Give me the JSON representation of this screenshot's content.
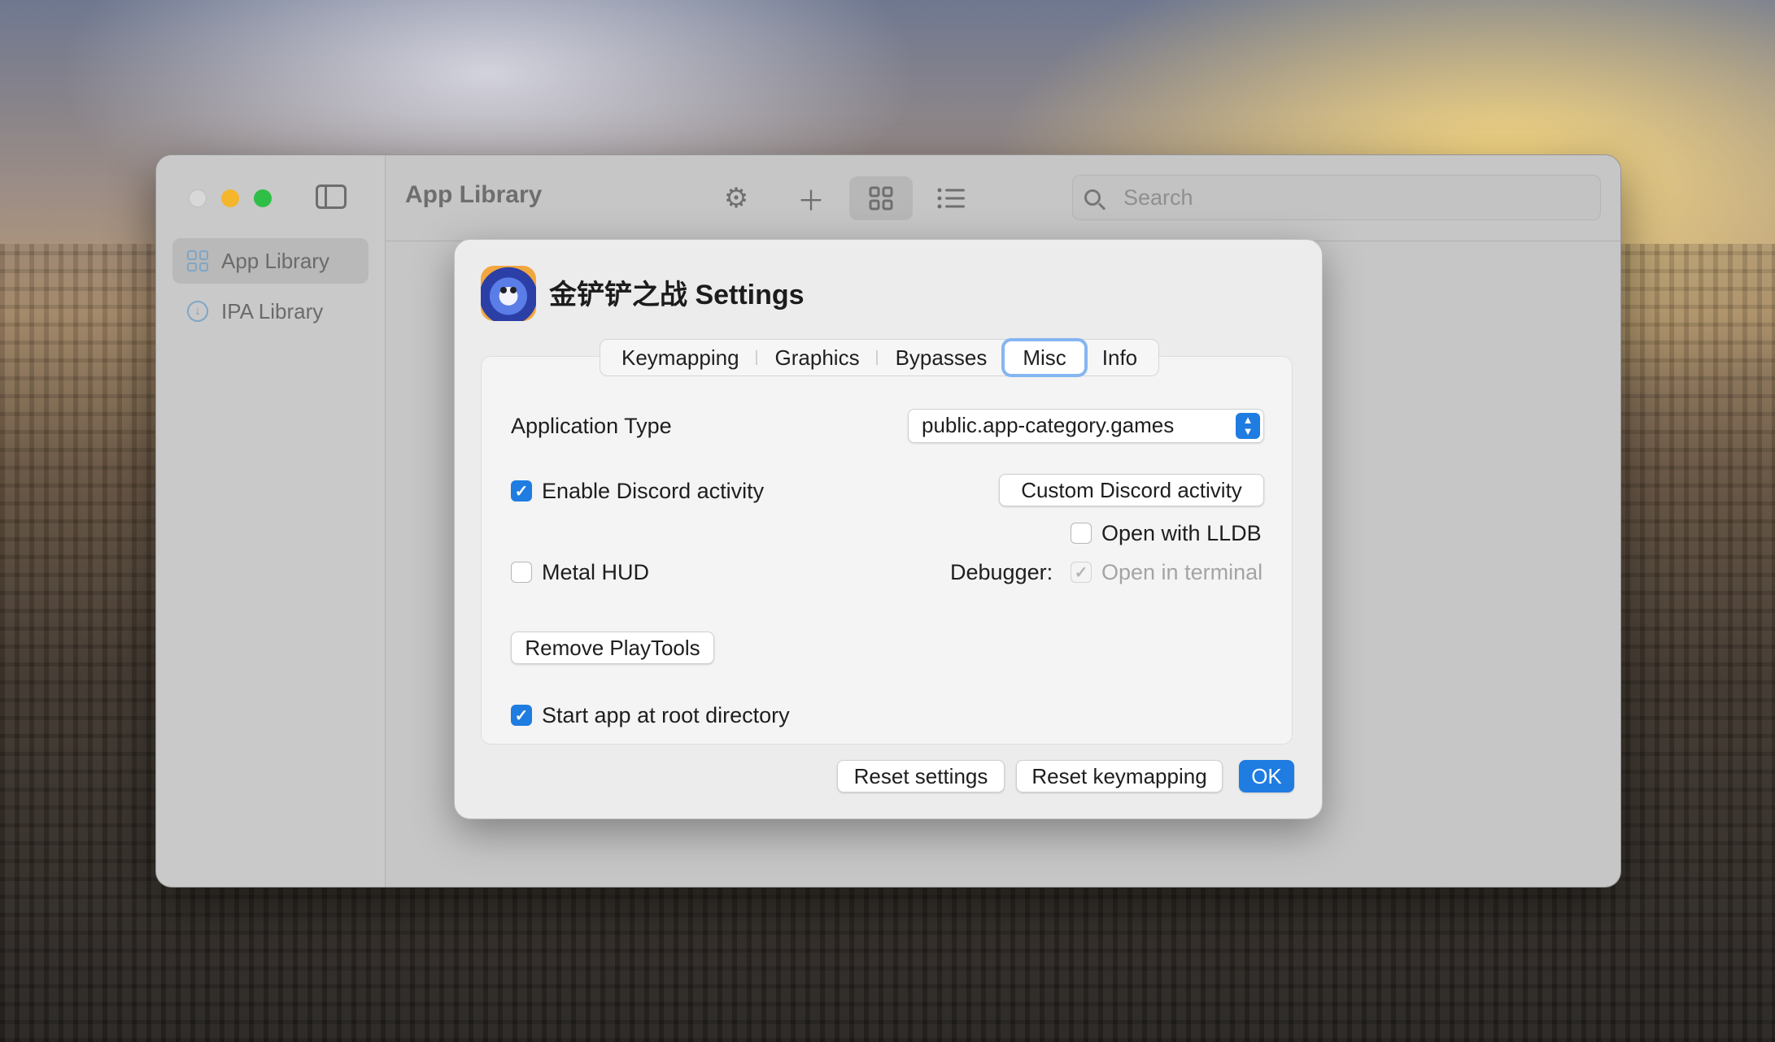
{
  "window": {
    "sidebar": {
      "items": [
        {
          "label": "App Library",
          "icon": "grid-icon",
          "selected": true
        },
        {
          "label": "IPA Library",
          "icon": "download-icon",
          "selected": false
        }
      ]
    },
    "toolbar": {
      "title": "App Library",
      "search_placeholder": "Search",
      "buttons": [
        "settings-gear-icon",
        "add-icon",
        "grid-view-icon",
        "list-view-icon"
      ]
    }
  },
  "dialog": {
    "title": "金铲铲之战 Settings",
    "tabs": [
      "Keymapping",
      "Graphics",
      "Bypasses",
      "Misc",
      "Info"
    ],
    "active_tab": "Misc",
    "misc": {
      "application_type_label": "Application Type",
      "application_type_value": "public.app-category.games",
      "enable_discord_label": "Enable Discord activity",
      "enable_discord_checked": true,
      "custom_discord_button": "Custom Discord activity",
      "metal_hud_label": "Metal HUD",
      "metal_hud_checked": false,
      "debugger_label": "Debugger:",
      "open_lldb_label": "Open with LLDB",
      "open_lldb_checked": false,
      "open_terminal_label": "Open in terminal",
      "open_terminal_checked": true,
      "remove_playtools_button": "Remove PlayTools",
      "start_root_label": "Start app at root directory",
      "start_root_checked": true
    },
    "footer": {
      "reset_settings": "Reset settings",
      "reset_keymapping": "Reset keymapping",
      "ok": "OK"
    }
  },
  "colors": {
    "accent": "#1f7ce0",
    "focus_ring": "#86b6f2"
  }
}
